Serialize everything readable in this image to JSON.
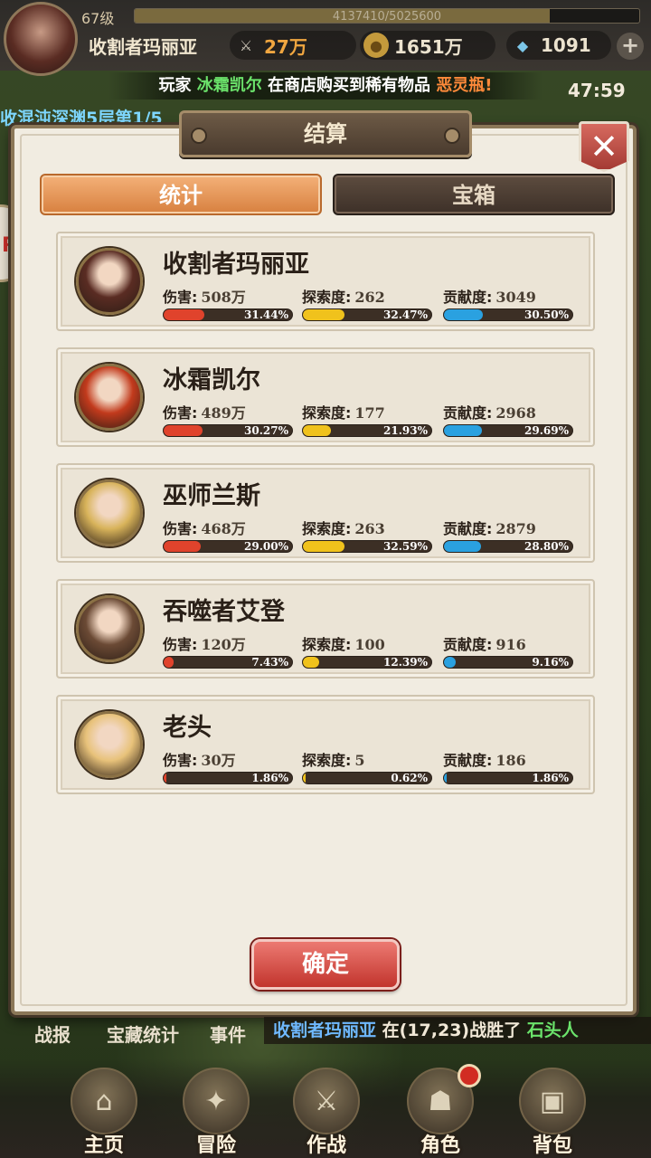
{
  "hud": {
    "level": "67级",
    "exp_text": "4137410/5025600",
    "exp_fraction": 0.823,
    "player_name": "收割者玛丽亚",
    "power": "27万",
    "gold": "1651万",
    "gems": "1091",
    "timer": "47:59",
    "map_info": "收混沌深渊5层第1/5"
  },
  "marquee": {
    "prefix": "玩家",
    "player": "冰霜凯尔",
    "middle": "在商店购买到稀有物品",
    "item": "恶灵瓶!"
  },
  "dialog": {
    "title": "结算",
    "tabs": [
      {
        "label": "统计",
        "active": true
      },
      {
        "label": "宝箱",
        "active": false
      }
    ],
    "confirm_label": "确定",
    "metric_labels": {
      "damage": "伤害:",
      "explore": "探索度:",
      "contribution": "贡献度:"
    },
    "players": [
      {
        "name": "收割者玛丽亚",
        "portrait_color": "#5a2c23",
        "damage": "508万",
        "damage_pct": "31.44%",
        "damage_frac": 0.3144,
        "explore": "262",
        "explore_pct": "32.47%",
        "explore_frac": 0.3247,
        "contribution": "3049",
        "contribution_pct": "30.50%",
        "contribution_frac": 0.305
      },
      {
        "name": "冰霜凯尔",
        "portrait_color": "#c23a1c",
        "damage": "489万",
        "damage_pct": "30.27%",
        "damage_frac": 0.3027,
        "explore": "177",
        "explore_pct": "21.93%",
        "explore_frac": 0.2193,
        "contribution": "2968",
        "contribution_pct": "29.69%",
        "contribution_frac": 0.2969
      },
      {
        "name": "巫师兰斯",
        "portrait_color": "#d8b35a",
        "damage": "468万",
        "damage_pct": "29.00%",
        "damage_frac": 0.29,
        "explore": "263",
        "explore_pct": "32.59%",
        "explore_frac": 0.3259,
        "contribution": "2879",
        "contribution_pct": "28.80%",
        "contribution_frac": 0.288
      },
      {
        "name": "吞噬者艾登",
        "portrait_color": "#6b4a35",
        "damage": "120万",
        "damage_pct": "7.43%",
        "damage_frac": 0.0743,
        "explore": "100",
        "explore_pct": "12.39%",
        "explore_frac": 0.1239,
        "contribution": "916",
        "contribution_pct": "9.16%",
        "contribution_frac": 0.0916
      },
      {
        "name": "老头",
        "portrait_color": "#e8c27a",
        "damage": "30万",
        "damage_pct": "1.86%",
        "damage_frac": 0.0186,
        "explore": "5",
        "explore_pct": "0.62%",
        "explore_frac": 0.0062,
        "contribution": "186",
        "contribution_pct": "1.86%",
        "contribution_frac": 0.0186
      }
    ]
  },
  "bottom": {
    "tabs": [
      "战报",
      "宝藏统计",
      "事件"
    ],
    "battle_msg": {
      "name": "收割者玛丽亚",
      "middle": "在(17,23)战胜了",
      "enemy": "石头人"
    },
    "nav": [
      {
        "label": "主页",
        "icon": "home-icon",
        "glyph": "⌂"
      },
      {
        "label": "冒险",
        "icon": "adventure-icon",
        "glyph": "✦"
      },
      {
        "label": "作战",
        "icon": "battle-icon",
        "glyph": "⚔"
      },
      {
        "label": "角色",
        "icon": "character-icon",
        "glyph": "☗",
        "badge": true
      },
      {
        "label": "背包",
        "icon": "backpack-icon",
        "glyph": "▣"
      }
    ]
  },
  "colors": {
    "damage": "#e0432c",
    "explore": "#f0c21c",
    "contribution": "#2aa1e0",
    "confirm": "#c2342d",
    "tab_active": "#d7803f"
  }
}
